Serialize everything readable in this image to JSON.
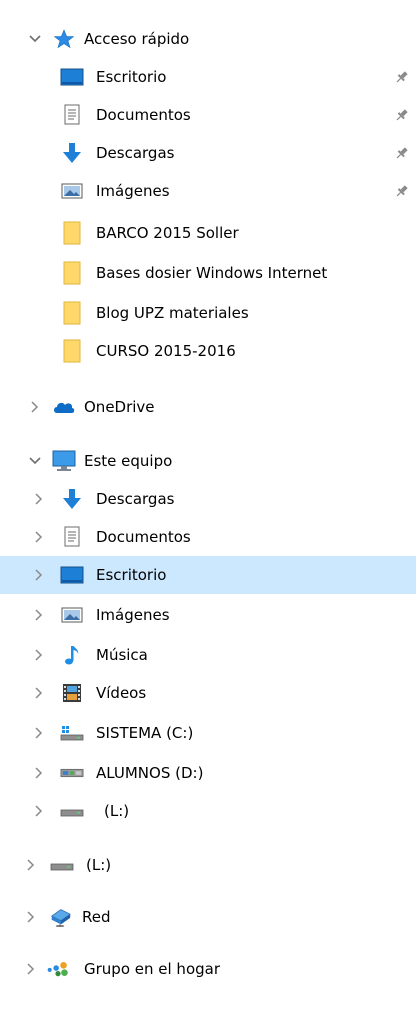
{
  "nav": {
    "quick_access": {
      "label": "Acceso rápido",
      "items": [
        {
          "label": "Escritorio"
        },
        {
          "label": "Documentos"
        },
        {
          "label": "Descargas"
        },
        {
          "label": "Imágenes"
        },
        {
          "label": "BARCO 2015 Soller"
        },
        {
          "label": "Bases dosier Windows Internet"
        },
        {
          "label": "Blog UPZ materiales"
        },
        {
          "label": "CURSO 2015-2016"
        }
      ]
    },
    "onedrive": {
      "label": "OneDrive"
    },
    "this_pc": {
      "label": "Este equipo",
      "items": [
        {
          "label": "Descargas"
        },
        {
          "label": "Documentos"
        },
        {
          "label": "Escritorio"
        },
        {
          "label": "Imágenes"
        },
        {
          "label": "Música"
        },
        {
          "label": "Vídeos"
        },
        {
          "label": "SISTEMA (C:)"
        },
        {
          "label": "ALUMNOS (D:)"
        },
        {
          "label": "(L:)"
        }
      ]
    },
    "drive_l": {
      "label": "(L:)"
    },
    "network": {
      "label": "Red"
    },
    "homegroup": {
      "label": "Grupo en el hogar"
    }
  },
  "colors": {
    "selection": "#cce8ff",
    "chevron": "#7a7a7a",
    "folder": "#ffd86b",
    "accent": "#1e7fd6"
  }
}
